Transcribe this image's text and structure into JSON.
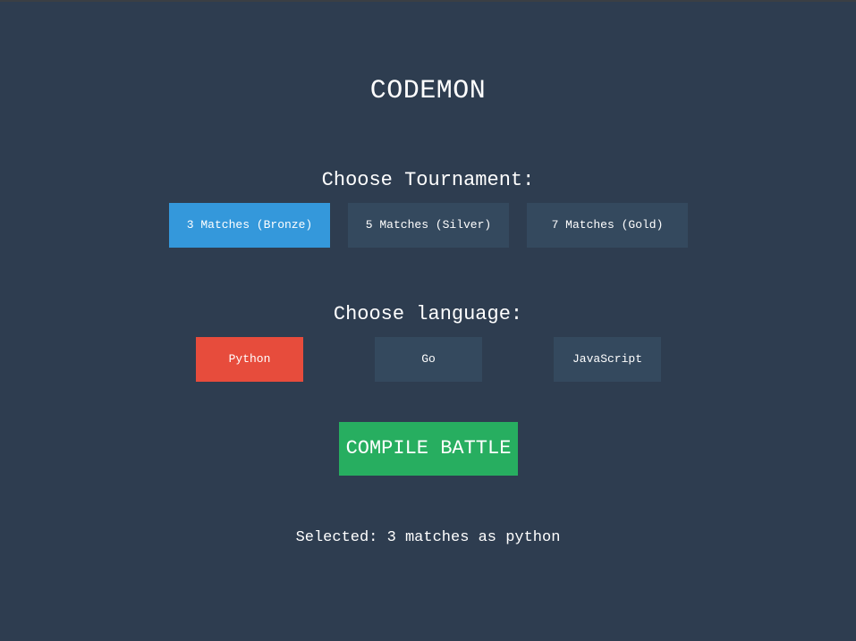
{
  "app": {
    "title": "CODEMON"
  },
  "tournament": {
    "label": "Choose Tournament:",
    "options": [
      {
        "label": "3 Matches (Bronze)",
        "selected": true
      },
      {
        "label": "5 Matches (Silver)",
        "selected": false
      },
      {
        "label": "7 Matches (Gold)",
        "selected": false
      }
    ]
  },
  "language": {
    "label": "Choose language:",
    "options": [
      {
        "label": "Python",
        "selected": true
      },
      {
        "label": "Go",
        "selected": false
      },
      {
        "label": "JavaScript",
        "selected": false
      }
    ]
  },
  "actions": {
    "compile_label": "COMPILE BATTLE"
  },
  "status": {
    "text": "Selected: 3 matches as python"
  },
  "colors": {
    "background": "#2e3d50",
    "button_default": "#34495e",
    "tournament_selected": "#3498db",
    "language_selected": "#e74c3c",
    "compile": "#27ae60"
  }
}
